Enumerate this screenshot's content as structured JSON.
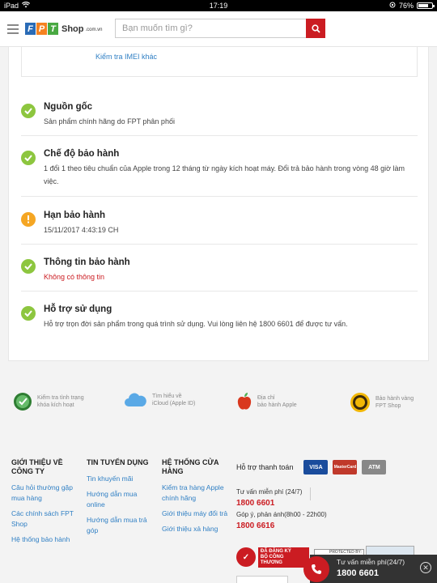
{
  "status_bar": {
    "device": "iPad",
    "time": "17:19",
    "battery": "76%",
    "battery_level": 0.76
  },
  "header": {
    "logo": {
      "letters": [
        "F",
        "P",
        "T"
      ],
      "name": "Shop",
      "domain": ".com.vn"
    },
    "search": {
      "placeholder": "Bạn muốn tìm gì?",
      "value": ""
    }
  },
  "imei_check": {
    "link": "Kiểm tra IMEI khác"
  },
  "info_items": [
    {
      "status": "ok",
      "title": "Nguồn gốc",
      "desc": "Sản phẩm chính hãng do FPT phân phối"
    },
    {
      "status": "ok",
      "title": "Chế độ bảo hành",
      "desc": "1 đổi 1 theo tiêu chuẩn của Apple trong 12 tháng từ ngày kích hoạt máy. Đổi trả bảo hành trong vòng 48 giờ làm việc."
    },
    {
      "status": "warning",
      "title": "Hạn bảo hành",
      "desc": "15/11/2017 4:43:19 CH"
    },
    {
      "status": "ok",
      "title": "Thông tin bảo hành",
      "desc": "Không có thông tin"
    },
    {
      "status": "ok",
      "title": "Hỗ trợ sử dụng",
      "desc": "Hỗ trợ trọn đời sản phẩm trong quá trình sử dụng. Vui lòng liên hệ 1800 6601 để được tư vấn."
    }
  ],
  "features": [
    {
      "icon": "activation-check-icon",
      "line1": "Kiểm tra tình trạng",
      "line2": "khóa kích hoạt"
    },
    {
      "icon": "icloud-icon",
      "line1": "Tìm hiểu về",
      "line2": "iCloud (Apple ID)"
    },
    {
      "icon": "apple-icon",
      "line1": "Địa chỉ",
      "line2": "bảo hành Apple"
    },
    {
      "icon": "warranty-badge-icon",
      "line1": "Bảo hành vàng",
      "line2": "FPT Shop"
    }
  ],
  "footer": {
    "columns": [
      {
        "title": "GIỚI THIỆU VỀ CÔNG TY",
        "links": [
          "Câu hỏi thường gặp mua hàng",
          "Các chính sách FPT Shop",
          "Hệ thống bảo hành"
        ]
      },
      {
        "title": "TIN TUYỂN DỤNG",
        "links": [
          "Tin khuyến mãi",
          "Hướng dẫn mua online",
          "Hướng dẫn mua trả góp"
        ]
      },
      {
        "title": "HỆ THỐNG CỬA HÀNG",
        "links": [
          "Kiểm tra hàng Apple chính hãng",
          "Giới thiệu máy đổi trả",
          "Giới thiệu xả hàng"
        ]
      }
    ],
    "payment": {
      "label": "Hỗ trợ thanh toán",
      "cards": [
        "VISA",
        "MasterCard",
        "ATM"
      ]
    },
    "hotline": {
      "free_label": "Tư vấn miễn phí (24/7)",
      "free_number": "1800 6601",
      "complaint_label": "Góp ý, phản ánh(8h00 - 22h00)",
      "complaint_number": "1800 6616"
    },
    "badges": {
      "registered": "ĐÃ ĐĂNG KÝ",
      "registered_sub": "BỘ CÔNG THƯƠNG",
      "protected": "PROTECTED BY:"
    }
  },
  "call_bar": {
    "label": "Tư vấn miễn phí(24/7)",
    "number": "1800 6601"
  },
  "colors": {
    "accent": "#cb1c22",
    "link": "#2f7fc4",
    "ok": "#8dc63f",
    "warning": "#f5a623"
  }
}
